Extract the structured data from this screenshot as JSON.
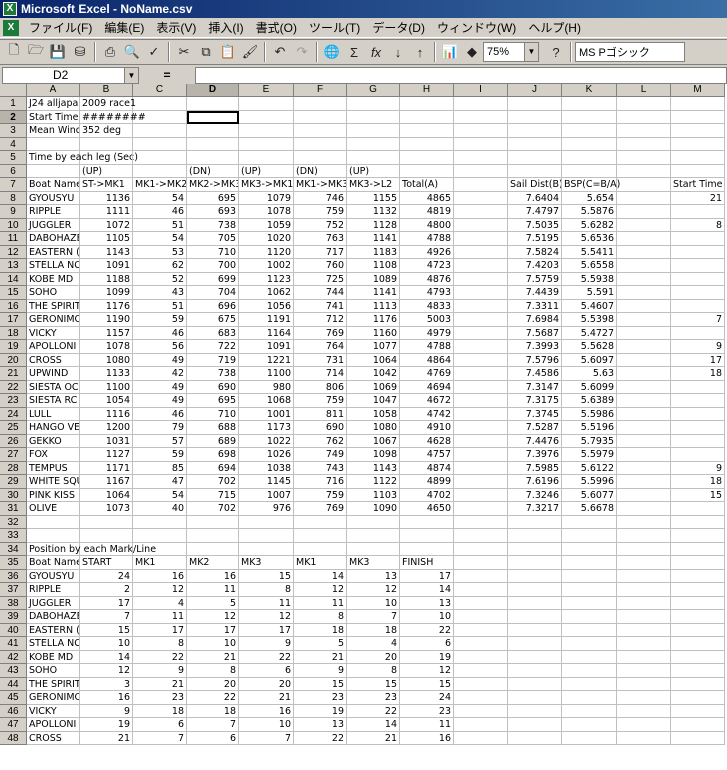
{
  "window": {
    "title": "Microsoft Excel - NoName.csv"
  },
  "menu": [
    "ファイル(F)",
    "編集(E)",
    "表示(V)",
    "挿入(I)",
    "書式(O)",
    "ツール(T)",
    "データ(D)",
    "ウィンドウ(W)",
    "ヘルプ(H)"
  ],
  "toolbar": {
    "zoom": "75%",
    "font": "MS Pゴシック"
  },
  "formula_bar": {
    "name_box": "D2",
    "equals": "="
  },
  "columns": [
    "A",
    "B",
    "C",
    "D",
    "E",
    "F",
    "G",
    "H",
    "I",
    "J",
    "K",
    "L",
    "M"
  ],
  "selected_column": "D",
  "selected_row": 2,
  "rows": [
    {
      "n": 1,
      "cells": [
        "J24 alljapan",
        "2009 race1",
        "",
        "",
        "",
        "",
        "",
        "",
        "",
        "",
        "",
        "",
        ""
      ]
    },
    {
      "n": 2,
      "cells": [
        "Start Time",
        "########",
        "",
        "",
        "",
        "",
        "",
        "",
        "",
        "",
        "",
        "",
        ""
      ]
    },
    {
      "n": 3,
      "cells": [
        "Mean Wind",
        "352 deg",
        "",
        "",
        "",
        "",
        "",
        "",
        "",
        "",
        "",
        "",
        ""
      ]
    },
    {
      "n": 4,
      "cells": [
        "",
        "",
        "",
        "",
        "",
        "",
        "",
        "",
        "",
        "",
        "",
        "",
        ""
      ]
    },
    {
      "n": 5,
      "cells": [
        "Time by each leg (Sec)",
        "",
        "",
        "",
        "",
        "",
        "",
        "",
        "",
        "",
        "",
        "",
        ""
      ]
    },
    {
      "n": 6,
      "cells": [
        "",
        "(UP)",
        "",
        "(DN)",
        "(UP)",
        "(DN)",
        "(UP)",
        "",
        "",
        "",
        "",
        "",
        ""
      ]
    },
    {
      "n": 7,
      "cells": [
        "Boat Name",
        "ST->MK1",
        "MK1->MK2",
        "MK2->MK3",
        "MK3->MK1",
        "MK1->MK3",
        "MK3->L2",
        "Total(A)",
        "",
        "Sail Dist(B)",
        "BSP(C=B/A)",
        "",
        "Start Time"
      ]
    },
    {
      "n": 8,
      "cells": [
        "GYOUSYU",
        "1136",
        "54",
        "695",
        "1079",
        "746",
        "1155",
        "4865",
        "",
        "7.6404",
        "5.654",
        "",
        "21"
      ]
    },
    {
      "n": 9,
      "cells": [
        "RIPPLE",
        "1111",
        "46",
        "693",
        "1078",
        "759",
        "1132",
        "4819",
        "",
        "7.4797",
        "5.5876",
        "",
        ""
      ]
    },
    {
      "n": 10,
      "cells": [
        "JUGGLER",
        "1072",
        "51",
        "738",
        "1059",
        "752",
        "1128",
        "4800",
        "",
        "7.5035",
        "5.6282",
        "",
        "8"
      ]
    },
    {
      "n": 11,
      "cells": [
        "DABOHAZE",
        "1105",
        "54",
        "705",
        "1020",
        "763",
        "1141",
        "4788",
        "",
        "7.5195",
        "5.6536",
        "",
        ""
      ]
    },
    {
      "n": 12,
      "cells": [
        "EASTERN (",
        "1143",
        "53",
        "710",
        "1120",
        "717",
        "1183",
        "4926",
        "",
        "7.5824",
        "5.5411",
        "",
        ""
      ]
    },
    {
      "n": 13,
      "cells": [
        "STELLA NC",
        "1091",
        "62",
        "700",
        "1002",
        "760",
        "1108",
        "4723",
        "",
        "7.4203",
        "5.6558",
        "",
        ""
      ]
    },
    {
      "n": 14,
      "cells": [
        "KOBE MD",
        "1188",
        "52",
        "699",
        "1123",
        "725",
        "1089",
        "4876",
        "",
        "7.5759",
        "5.5938",
        "",
        ""
      ]
    },
    {
      "n": 15,
      "cells": [
        "SOHO",
        "1099",
        "43",
        "704",
        "1062",
        "744",
        "1141",
        "4793",
        "",
        "7.4439",
        "5.591",
        "",
        ""
      ]
    },
    {
      "n": 16,
      "cells": [
        "THE SPIRIT",
        "1176",
        "51",
        "696",
        "1056",
        "741",
        "1113",
        "4833",
        "",
        "7.3311",
        "5.4607",
        "",
        ""
      ]
    },
    {
      "n": 17,
      "cells": [
        "GERONIMO",
        "1190",
        "59",
        "675",
        "1191",
        "712",
        "1176",
        "5003",
        "",
        "7.6984",
        "5.5398",
        "",
        "7"
      ]
    },
    {
      "n": 18,
      "cells": [
        "VICKY",
        "1157",
        "46",
        "683",
        "1164",
        "769",
        "1160",
        "4979",
        "",
        "7.5687",
        "5.4727",
        "",
        ""
      ]
    },
    {
      "n": 19,
      "cells": [
        "APOLLONI",
        "1078",
        "56",
        "722",
        "1091",
        "764",
        "1077",
        "4788",
        "",
        "7.3993",
        "5.5628",
        "",
        "9"
      ]
    },
    {
      "n": 20,
      "cells": [
        "CROSS",
        "1080",
        "49",
        "719",
        "1221",
        "731",
        "1064",
        "4864",
        "",
        "7.5796",
        "5.6097",
        "",
        "17"
      ]
    },
    {
      "n": 21,
      "cells": [
        "UPWIND",
        "1133",
        "42",
        "738",
        "1100",
        "714",
        "1042",
        "4769",
        "",
        "7.4586",
        "5.63",
        "",
        "18"
      ]
    },
    {
      "n": 22,
      "cells": [
        "SIESTA OC",
        "1100",
        "49",
        "690",
        "980",
        "806",
        "1069",
        "4694",
        "",
        "7.3147",
        "5.6099",
        "",
        ""
      ]
    },
    {
      "n": 23,
      "cells": [
        "SIESTA RC",
        "1054",
        "49",
        "695",
        "1068",
        "759",
        "1047",
        "4672",
        "",
        "7.3175",
        "5.6389",
        "",
        ""
      ]
    },
    {
      "n": 24,
      "cells": [
        "LULL",
        "1116",
        "46",
        "710",
        "1001",
        "811",
        "1058",
        "4742",
        "",
        "7.3745",
        "5.5986",
        "",
        ""
      ]
    },
    {
      "n": 25,
      "cells": [
        "HANGO VEI",
        "1200",
        "79",
        "688",
        "1173",
        "690",
        "1080",
        "4910",
        "",
        "7.5287",
        "5.5196",
        "",
        ""
      ]
    },
    {
      "n": 26,
      "cells": [
        "GEKKO",
        "1031",
        "57",
        "689",
        "1022",
        "762",
        "1067",
        "4628",
        "",
        "7.4476",
        "5.7935",
        "",
        ""
      ]
    },
    {
      "n": 27,
      "cells": [
        "FOX",
        "1127",
        "59",
        "698",
        "1026",
        "749",
        "1098",
        "4757",
        "",
        "7.3976",
        "5.5979",
        "",
        ""
      ]
    },
    {
      "n": 28,
      "cells": [
        "TEMPUS",
        "1171",
        "85",
        "694",
        "1038",
        "743",
        "1143",
        "4874",
        "",
        "7.5985",
        "5.6122",
        "",
        "9"
      ]
    },
    {
      "n": 29,
      "cells": [
        "WHITE SQU",
        "1167",
        "47",
        "702",
        "1145",
        "716",
        "1122",
        "4899",
        "",
        "7.6196",
        "5.5996",
        "",
        "18"
      ]
    },
    {
      "n": 30,
      "cells": [
        "PINK KISS",
        "1064",
        "54",
        "715",
        "1007",
        "759",
        "1103",
        "4702",
        "",
        "7.3246",
        "5.6077",
        "",
        "15"
      ]
    },
    {
      "n": 31,
      "cells": [
        "OLIVE",
        "1073",
        "40",
        "702",
        "976",
        "769",
        "1090",
        "4650",
        "",
        "7.3217",
        "5.6678",
        "",
        ""
      ]
    },
    {
      "n": 32,
      "cells": [
        "",
        "",
        "",
        "",
        "",
        "",
        "",
        "",
        "",
        "",
        "",
        "",
        ""
      ]
    },
    {
      "n": 33,
      "cells": [
        "",
        "",
        "",
        "",
        "",
        "",
        "",
        "",
        "",
        "",
        "",
        "",
        ""
      ]
    },
    {
      "n": 34,
      "cells": [
        "Position by each Mark/Line",
        "",
        "",
        "",
        "",
        "",
        "",
        "",
        "",
        "",
        "",
        "",
        ""
      ]
    },
    {
      "n": 35,
      "cells": [
        "Boat Name",
        "START",
        "MK1",
        "MK2",
        "MK3",
        "MK1",
        "MK3",
        "FINISH",
        "",
        "",
        "",
        "",
        ""
      ]
    },
    {
      "n": 36,
      "cells": [
        "GYOUSYU",
        "24",
        "16",
        "16",
        "15",
        "14",
        "13",
        "17",
        "",
        "",
        "",
        "",
        ""
      ]
    },
    {
      "n": 37,
      "cells": [
        "RIPPLE",
        "2",
        "12",
        "11",
        "8",
        "12",
        "12",
        "14",
        "",
        "",
        "",
        "",
        ""
      ]
    },
    {
      "n": 38,
      "cells": [
        "JUGGLER",
        "17",
        "4",
        "5",
        "11",
        "11",
        "10",
        "13",
        "",
        "",
        "",
        "",
        ""
      ]
    },
    {
      "n": 39,
      "cells": [
        "DABOHAZE",
        "7",
        "11",
        "12",
        "12",
        "8",
        "7",
        "10",
        "",
        "",
        "",
        "",
        ""
      ]
    },
    {
      "n": 40,
      "cells": [
        "EASTERN (",
        "15",
        "17",
        "17",
        "17",
        "18",
        "18",
        "22",
        "",
        "",
        "",
        "",
        ""
      ]
    },
    {
      "n": 41,
      "cells": [
        "STELLA NC",
        "10",
        "8",
        "10",
        "9",
        "5",
        "4",
        "6",
        "",
        "",
        "",
        "",
        ""
      ]
    },
    {
      "n": 42,
      "cells": [
        "KOBE MD",
        "14",
        "22",
        "21",
        "22",
        "21",
        "20",
        "19",
        "",
        "",
        "",
        "",
        ""
      ]
    },
    {
      "n": 43,
      "cells": [
        "SOHO",
        "12",
        "9",
        "8",
        "6",
        "9",
        "8",
        "12",
        "",
        "",
        "",
        "",
        ""
      ]
    },
    {
      "n": 44,
      "cells": [
        "THE SPIRIT",
        "3",
        "21",
        "20",
        "20",
        "15",
        "15",
        "15",
        "",
        "",
        "",
        "",
        ""
      ]
    },
    {
      "n": 45,
      "cells": [
        "GERONIMO",
        "16",
        "23",
        "22",
        "21",
        "23",
        "23",
        "24",
        "",
        "",
        "",
        "",
        ""
      ]
    },
    {
      "n": 46,
      "cells": [
        "VICKY",
        "9",
        "18",
        "18",
        "16",
        "19",
        "22",
        "23",
        "",
        "",
        "",
        "",
        ""
      ]
    },
    {
      "n": 47,
      "cells": [
        "APOLLONI",
        "19",
        "6",
        "7",
        "10",
        "13",
        "14",
        "11",
        "",
        "",
        "",
        "",
        ""
      ]
    },
    {
      "n": 48,
      "cells": [
        "CROSS",
        "21",
        "7",
        "6",
        "7",
        "22",
        "21",
        "16",
        "",
        "",
        "",
        "",
        ""
      ]
    }
  ]
}
